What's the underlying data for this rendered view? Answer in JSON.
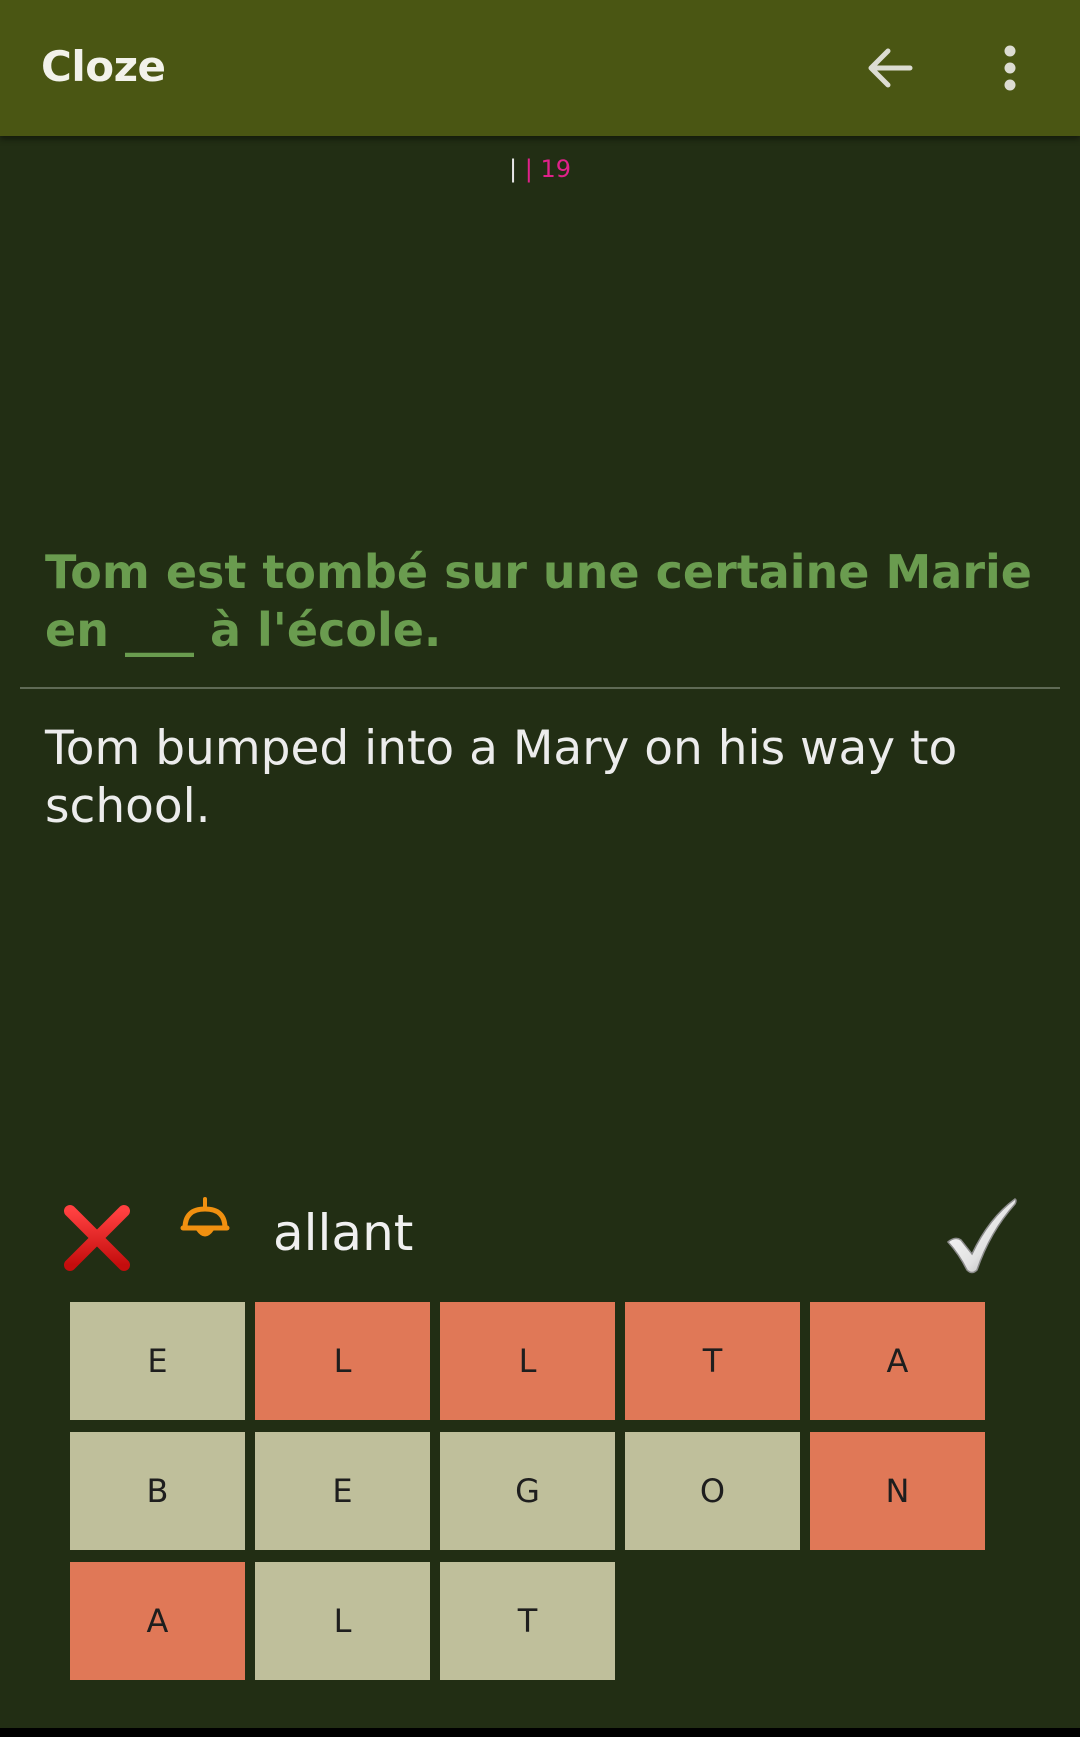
{
  "appbar": {
    "title": "Cloze",
    "back_icon": "arrow-left-icon",
    "menu_icon": "more-vert-icon"
  },
  "counter": {
    "sep1": "|",
    "sep2": "|",
    "value": "19"
  },
  "question": "Tom est tombé sur une certaine Marie en ___ à l'école.",
  "translation": "Tom bumped into a Mary on his way to school.",
  "answer": {
    "text": "allant",
    "clear_icon": "red-x-icon",
    "hint_icon": "bell-icon",
    "check_icon": "checkmark-icon"
  },
  "tiles": [
    {
      "letter": "E",
      "used": false
    },
    {
      "letter": "L",
      "used": true
    },
    {
      "letter": "L",
      "used": true
    },
    {
      "letter": "T",
      "used": true
    },
    {
      "letter": "A",
      "used": true
    },
    {
      "letter": "B",
      "used": false
    },
    {
      "letter": "E",
      "used": false
    },
    {
      "letter": "G",
      "used": false
    },
    {
      "letter": "O",
      "used": false
    },
    {
      "letter": "N",
      "used": true
    },
    {
      "letter": "A",
      "used": true
    },
    {
      "letter": "L",
      "used": false
    },
    {
      "letter": "T",
      "used": false
    }
  ],
  "colors": {
    "appbar": "#4a5613",
    "background": "#222e14",
    "question": "#6a9c4f",
    "tile_unused": "#bfbf9b",
    "tile_used": "#e07857",
    "counter_accent": "#e0218a"
  }
}
